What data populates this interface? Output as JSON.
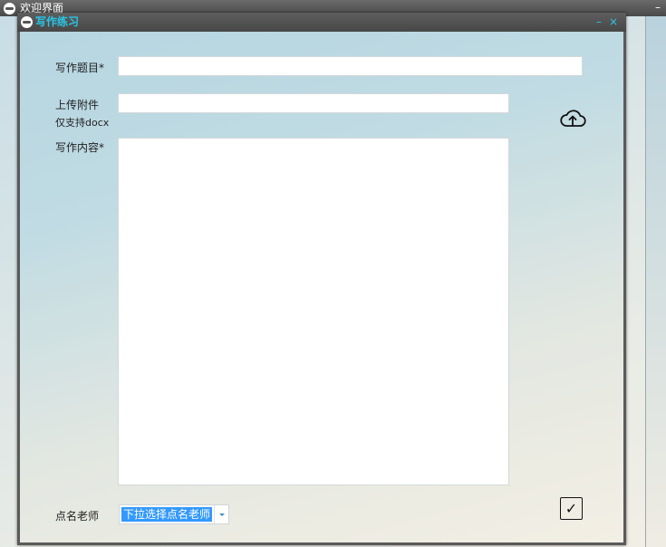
{
  "background_window": {
    "title": "欢迎界面",
    "minimize_label": "–"
  },
  "dialog": {
    "title": "写作练习",
    "minimize_label": "–",
    "close_label": "×"
  },
  "form": {
    "title_label": "写作题目*",
    "title_value": "",
    "attachment_label": "上传附件",
    "attachment_hint": "仅支持docx",
    "attachment_value": "",
    "content_label": "写作内容*",
    "content_value": "",
    "teacher_label": "点名老师",
    "teacher_select_value": "下拉选择点名老师"
  },
  "icons": {
    "upload": "cloud-upload-icon",
    "submit": "checkmark-icon",
    "dropdown": "chevron-down-icon"
  },
  "colors": {
    "title_accent": "#27c7e8",
    "selection": "#3399ff"
  }
}
